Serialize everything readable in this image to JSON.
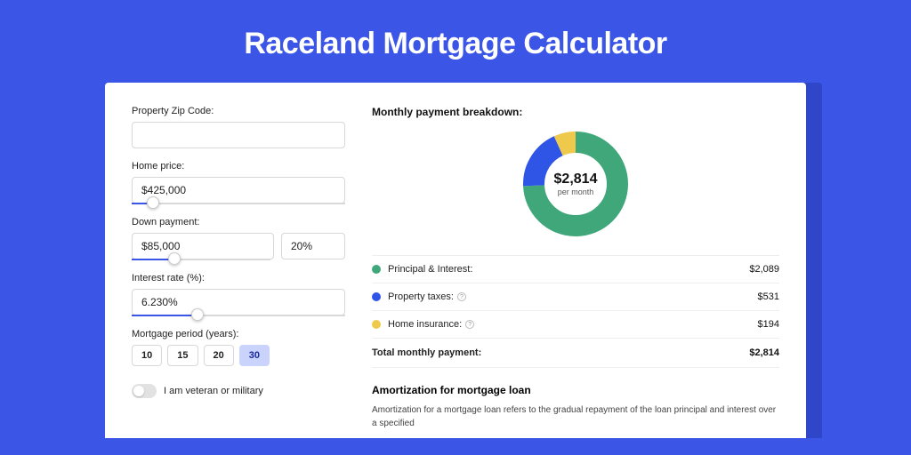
{
  "title": "Raceland Mortgage Calculator",
  "form": {
    "zip_label": "Property Zip Code:",
    "zip_value": "",
    "home_price_label": "Home price:",
    "home_price_value": "$425,000",
    "home_price_slider_pct": 10,
    "down_payment_label": "Down payment:",
    "down_payment_value": "$85,000",
    "down_payment_percent_value": "20%",
    "down_payment_slider_pct": 31,
    "interest_label": "Interest rate (%):",
    "interest_value": "6.230%",
    "interest_slider_pct": 31,
    "period_label": "Mortgage period (years):",
    "period_options": [
      "10",
      "15",
      "20",
      "30"
    ],
    "period_selected_index": 3,
    "veteran_label": "I am veteran or military"
  },
  "breakdown": {
    "title": "Monthly payment breakdown:",
    "donut_amount": "$2,814",
    "donut_sub": "per month",
    "items": [
      {
        "label": "Principal & Interest:",
        "value": "$2,089",
        "color": "#3fa77a",
        "has_info": false
      },
      {
        "label": "Property taxes:",
        "value": "$531",
        "color": "#2f55e6",
        "has_info": true
      },
      {
        "label": "Home insurance:",
        "value": "$194",
        "color": "#efc94c",
        "has_info": true
      }
    ],
    "total_label": "Total monthly payment:",
    "total_value": "$2,814"
  },
  "amortization": {
    "title": "Amortization for mortgage loan",
    "text": "Amortization for a mortgage loan refers to the gradual repayment of the loan principal and interest over a specified"
  },
  "chart_data": {
    "type": "pie",
    "title": "Monthly payment breakdown",
    "series": [
      {
        "name": "Principal & Interest",
        "value": 2089,
        "color": "#3fa77a"
      },
      {
        "name": "Property taxes",
        "value": 531,
        "color": "#2f55e6"
      },
      {
        "name": "Home insurance",
        "value": 194,
        "color": "#efc94c"
      }
    ],
    "total": 2814,
    "center_label": "$2,814 per month"
  }
}
